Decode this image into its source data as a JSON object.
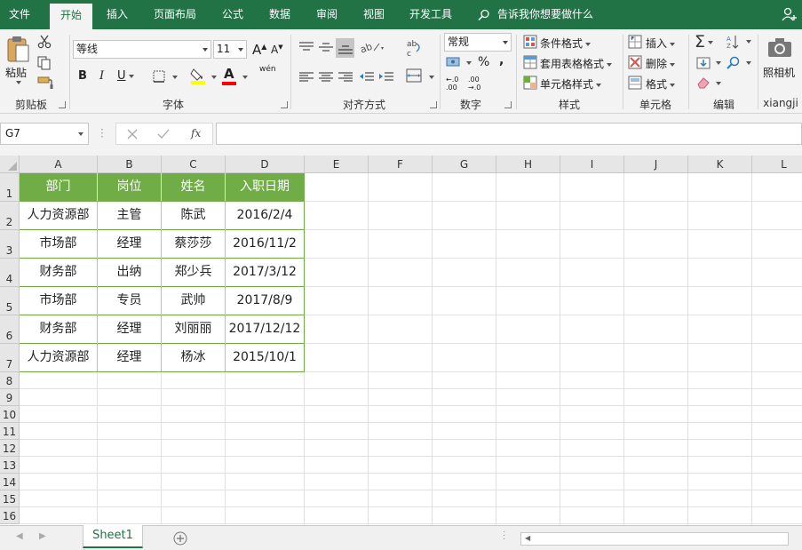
{
  "ribbon_tabs": [
    "文件",
    "开始",
    "插入",
    "页面布局",
    "公式",
    "数据",
    "审阅",
    "视图",
    "开发工具"
  ],
  "active_tab": "开始",
  "tell_me": "告诉我你想要做什么",
  "clipboard": {
    "paste": "粘贴",
    "label": "剪贴板"
  },
  "font": {
    "name": "等线",
    "size": "11",
    "label": "字体",
    "bold": "B",
    "italic": "I",
    "underline": "U",
    "color_letter": "A",
    "highlight_color": "#ffff00",
    "font_color": "#ff0000",
    "phonetic": "wén"
  },
  "alignment": {
    "label": "对齐方式"
  },
  "number": {
    "format": "常规",
    "label": "数字"
  },
  "styles": {
    "conditional": "条件格式",
    "table_format": "套用表格格式",
    "cell_styles": "单元格样式",
    "label": "样式"
  },
  "cells": {
    "insert": "插入",
    "delete": "删除",
    "format": "格式",
    "label": "单元格"
  },
  "editing": {
    "label": "编辑"
  },
  "camera": {
    "button": "照相机",
    "label": "xiangji"
  },
  "formula_bar": {
    "name_box": "G7",
    "fx": "fx",
    "value": ""
  },
  "columns": [
    "A",
    "B",
    "C",
    "D",
    "E",
    "F",
    "G",
    "H",
    "I",
    "J",
    "K",
    "L"
  ],
  "rows": [
    "1",
    "2",
    "3",
    "4",
    "5",
    "6",
    "7",
    "8",
    "9",
    "10",
    "11",
    "12",
    "13",
    "14",
    "15",
    "16"
  ],
  "table": {
    "headers": [
      "部门",
      "岗位",
      "姓名",
      "入职日期"
    ],
    "rows": [
      [
        "人力资源部",
        "主管",
        "陈武",
        "2016/2/4"
      ],
      [
        "市场部",
        "经理",
        "蔡莎莎",
        "2016/11/2"
      ],
      [
        "财务部",
        "出纳",
        "郑少兵",
        "2017/3/12"
      ],
      [
        "市场部",
        "专员",
        "武帅",
        "2017/8/9"
      ],
      [
        "财务部",
        "经理",
        "刘丽丽",
        "2017/12/12"
      ],
      [
        "人力资源部",
        "经理",
        "杨冰",
        "2015/10/1"
      ]
    ],
    "header_color": "#70ad47"
  },
  "sheet_tab": "Sheet1",
  "accent": "#217346"
}
